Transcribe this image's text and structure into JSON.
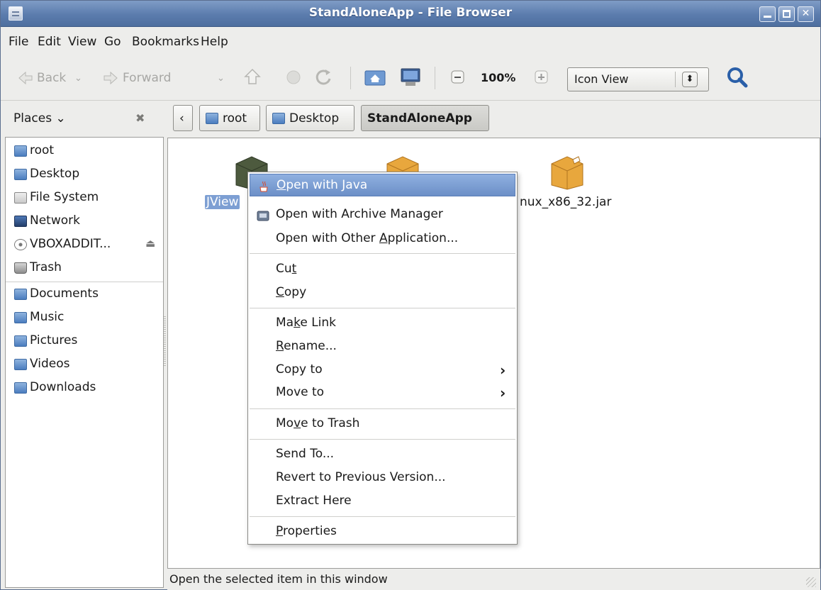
{
  "window": {
    "title": "StandAloneApp - File Browser"
  },
  "menubar": {
    "items": [
      "File",
      "Edit",
      "View",
      "Go",
      "Bookmarks",
      "Help"
    ]
  },
  "toolbar": {
    "back_label": "Back",
    "forward_label": "Forward",
    "zoom": "100%",
    "view_mode": "Icon View"
  },
  "sidebar": {
    "header": "Places",
    "items": [
      {
        "label": "root",
        "icon": "home-folder-icon"
      },
      {
        "label": "Desktop",
        "icon": "desktop-folder-icon"
      },
      {
        "label": "File System",
        "icon": "drive-icon"
      },
      {
        "label": "Network",
        "icon": "network-icon"
      },
      {
        "label": "VBOXADDIT...",
        "icon": "disc-icon"
      },
      {
        "label": "Trash",
        "icon": "trash-icon"
      },
      {
        "label": "Documents",
        "icon": "documents-folder-icon"
      },
      {
        "label": "Music",
        "icon": "music-folder-icon"
      },
      {
        "label": "Pictures",
        "icon": "pictures-folder-icon"
      },
      {
        "label": "Videos",
        "icon": "videos-folder-icon"
      },
      {
        "label": "Downloads",
        "icon": "downloads-folder-icon"
      }
    ]
  },
  "pathbar": {
    "items": [
      "root",
      "Desktop",
      "StandAloneApp"
    ]
  },
  "files": [
    {
      "label": "JView",
      "selected": true
    },
    {
      "label": "nux_x86_32.jar",
      "selected": false
    }
  ],
  "context_menu": {
    "items": [
      {
        "pre": "",
        "u": "O",
        "post": "pen with Java",
        "highlighted": true
      },
      {
        "pre": "",
        "u": "",
        "post": "Open with Archive Manager"
      },
      {
        "pre": "Open with Other ",
        "u": "A",
        "post": "pplication..."
      },
      {
        "pre": "Cu",
        "u": "t",
        "post": ""
      },
      {
        "pre": "",
        "u": "C",
        "post": "opy"
      },
      {
        "pre": "Ma",
        "u": "k",
        "post": "e Link"
      },
      {
        "pre": "",
        "u": "R",
        "post": "ename..."
      },
      {
        "pre": "Copy to",
        "u": "",
        "post": ""
      },
      {
        "pre": "Move to",
        "u": "",
        "post": ""
      },
      {
        "pre": "Mo",
        "u": "v",
        "post": "e to Trash"
      },
      {
        "pre": "Send To...",
        "u": "",
        "post": ""
      },
      {
        "pre": "Revert to Previous Version...",
        "u": "",
        "post": ""
      },
      {
        "pre": "Extract Here",
        "u": "",
        "post": ""
      },
      {
        "pre": "",
        "u": "P",
        "post": "roperties"
      }
    ]
  },
  "status": {
    "text": "Open the selected item in this window"
  },
  "colors": {
    "titlebar": "#5b7cad",
    "selection": "#7d9fd3",
    "jar": "#e3a23a"
  }
}
